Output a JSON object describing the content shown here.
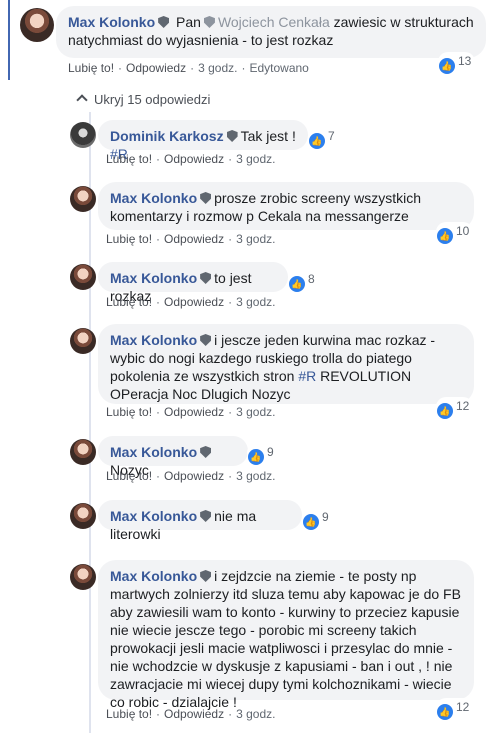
{
  "main_comment": {
    "author": "Max Kolonko",
    "text_prefix": "Pan",
    "mention": "Wojciech Cenkała",
    "text": "zawiesic w strukturach natychmiast do wyjasnienia - to jest rozkaz",
    "like_label": "Lubię to!",
    "reply_label": "Odpowiedz",
    "time": "3 godz.",
    "edited_label": "Edytowano",
    "reactions": "13"
  },
  "hide_replies_label": "Ukryj 15 odpowiedzi",
  "replies": [
    {
      "author": "Dominik Karkosz",
      "text": "Tak jest !",
      "hashtag": "#R",
      "reactions": "7",
      "like_label": "Lubię to!",
      "reply_label": "Odpowiedz",
      "time": "3 godz."
    },
    {
      "author": "Max Kolonko",
      "text": "prosze zrobic screeny wszystkich komentarzy i rozmow p Cekala na messangerze",
      "reactions": "10",
      "like_label": "Lubię to!",
      "reply_label": "Odpowiedz",
      "time": "3 godz."
    },
    {
      "author": "Max Kolonko",
      "text": "to jest rozkaz",
      "reactions": "8",
      "like_label": "Lubię to!",
      "reply_label": "Odpowiedz",
      "time": "3 godz."
    },
    {
      "author": "Max Kolonko",
      "text": "i jescze jeden kurwina mac rozkaz - wybic do nogi kazdego ruskiego trolla do piatego pokolenia ze wszystkich stron",
      "hashtag": "#R",
      "text_suffix": "REVOLUTION OPeracja Noc Dlugich Nozyc",
      "reactions": "12",
      "like_label": "Lubię to!",
      "reply_label": "Odpowiedz",
      "time": "3 godz."
    },
    {
      "author": "Max Kolonko",
      "text": "Nozyc",
      "reactions": "9",
      "like_label": "Lubię to!",
      "reply_label": "Odpowiedz",
      "time": "3 godz."
    },
    {
      "author": "Max Kolonko",
      "text": "nie ma literowki",
      "reactions": "9"
    },
    {
      "author": "Max Kolonko",
      "text": "i zejdzcie na ziemie - te posty np martwych zolnierzy itd sluza temu aby kapowac je do FB aby zawiesili wam to konto - kurwiny to przeciez kapusie nie wiecie jescze tego - porobic mi screeny takich prowokacji jesli macie watpliwosci i przesylac do mnie - nie wchodzcie w dyskusje z kapusiami - ban i out , ! nie zawracjacie mi wiecej dupy tymi kolchoznikami - wiecie co robic - dzialajcie !",
      "reactions": "12",
      "like_label": "Lubię to!",
      "reply_label": "Odpowiedz",
      "time": "3 godz."
    }
  ]
}
